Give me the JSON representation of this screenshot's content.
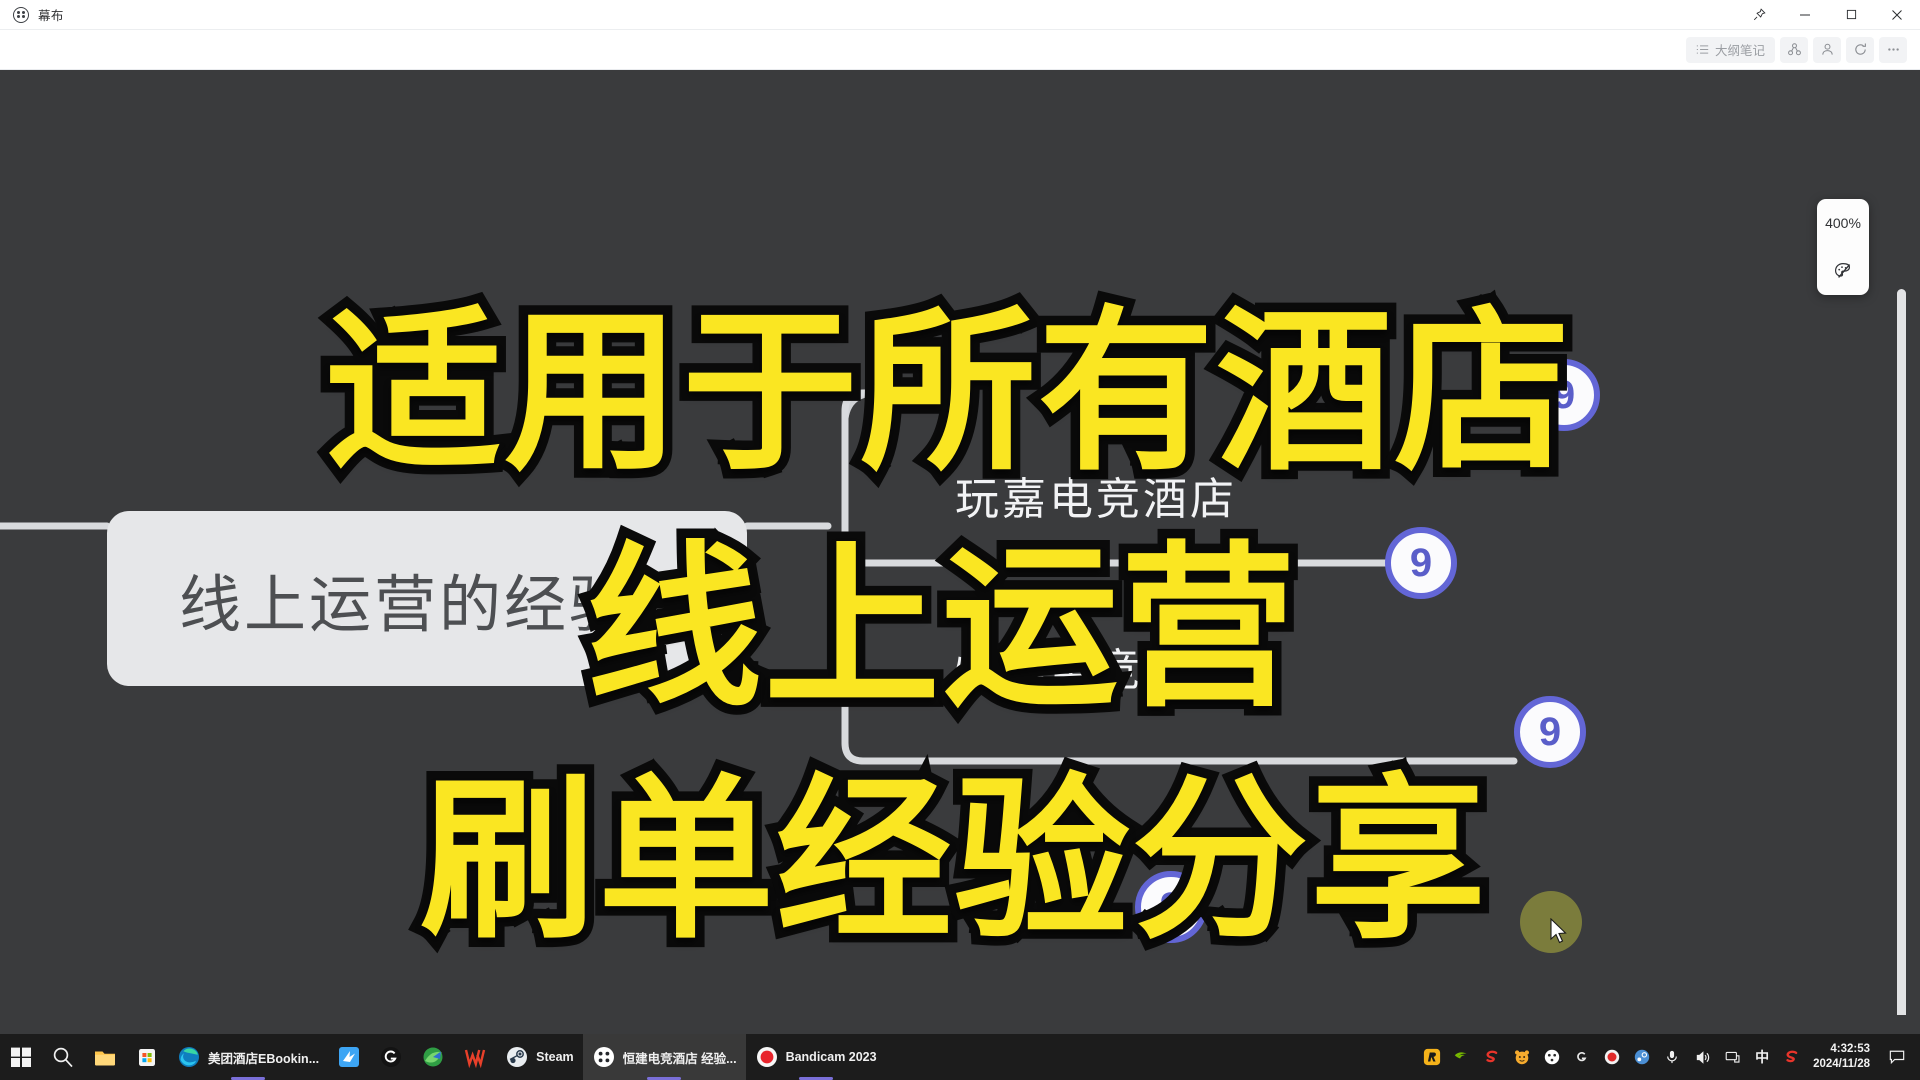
{
  "window": {
    "app_name": "幕布",
    "logo_icon": "mubu-dots-icon",
    "controls": {
      "pin": "pin-icon",
      "minimize": "minimize-icon",
      "maximize": "maximize-icon",
      "close": "close-icon"
    }
  },
  "toolbar": {
    "outline_notes_label": "大纲笔记",
    "outline_notes_icon": "list-icon",
    "share_icon": "share-nodes-icon",
    "members_icon": "user-icon",
    "refresh_icon": "refresh-icon",
    "more_icon": "ellipsis-icon"
  },
  "zoom_panel": {
    "level": "400%",
    "theme_icon": "palette-icon"
  },
  "mindmap": {
    "root": {
      "label": "线上运营的经验",
      "badge": null
    },
    "children": [
      {
        "label": "玩嘉电竞酒店",
        "badge": "9"
      },
      {
        "label": "恒建电竞酒店",
        "badge": "9"
      }
    ],
    "badges": [
      "9",
      "9",
      "9",
      "9"
    ],
    "connector_color": "#d8dadd",
    "badge_ring_color": "#6366d6",
    "badge_text_color": "#5a5ec9",
    "root_fill": "#e6e7e9",
    "canvas_background": "#3a3b3d"
  },
  "captions": {
    "color": "#FAE622",
    "stroke_color": "#0a0a0a",
    "lines": [
      "适用于所有酒店",
      "线上运营",
      "刷单经验分享"
    ]
  },
  "taskbar": {
    "start_icon": "windows-start-icon",
    "search_icon": "search-icon",
    "pinned": [
      {
        "name": "file-explorer",
        "label": ""
      },
      {
        "name": "microsoft-store",
        "label": ""
      },
      {
        "name": "microsoft-edge",
        "label": "美团酒店EBookin..."
      },
      {
        "name": "bluebird-app",
        "label": ""
      },
      {
        "name": "logitech-g-hub",
        "label": ""
      },
      {
        "name": "media-app",
        "label": ""
      },
      {
        "name": "wps-office",
        "label": ""
      },
      {
        "name": "steam",
        "label": "Steam"
      },
      {
        "name": "mubu",
        "label": "恒建电竞酒店 经验..."
      },
      {
        "name": "bandicam",
        "label": "Bandicam 2023"
      }
    ],
    "tray_icons": [
      "rockstar-icon",
      "nvidia-icon",
      "sogou-input-icon",
      "tiger-icon",
      "xbox-icon",
      "logitech-icon",
      "bandicam-record-icon",
      "steam-icon",
      "microphone-icon",
      "volume-icon",
      "display-icon"
    ],
    "ime_label": "中",
    "ime_extra_icon": "sogou-pinyin-icon",
    "clock_time": "4:32:53",
    "clock_date": "2024/11/28",
    "notification_icon": "notification-icon"
  }
}
